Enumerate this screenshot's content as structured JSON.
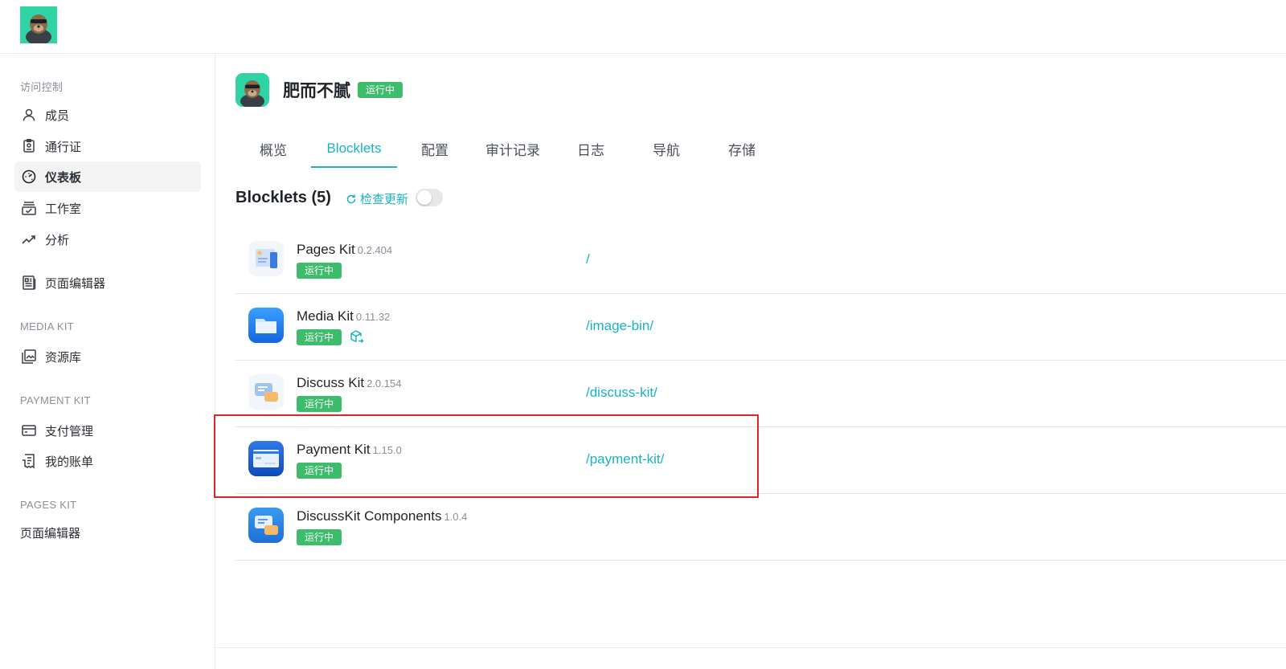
{
  "header": {
    "logo_icon": "otter-mascot-logo"
  },
  "sidebar": {
    "groups": [
      {
        "title": "访问控制",
        "items": [
          {
            "label": "成员",
            "icon": "user-icon"
          },
          {
            "label": "通行证",
            "icon": "pass-icon"
          },
          {
            "label": "仪表板",
            "icon": "dashboard-icon",
            "active": true
          },
          {
            "label": "工作室",
            "icon": "studio-icon"
          },
          {
            "label": "分析",
            "icon": "analytics-icon"
          },
          {
            "label": "页面编辑器",
            "icon": "newspaper-icon"
          }
        ]
      },
      {
        "title": "MEDIA KIT",
        "items": [
          {
            "label": "资源库",
            "icon": "image-library-icon"
          }
        ]
      },
      {
        "title": "PAYMENT KIT",
        "items": [
          {
            "label": "支付管理",
            "icon": "credit-card-icon"
          },
          {
            "label": "我的账单",
            "icon": "bill-icon"
          }
        ]
      },
      {
        "title": "PAGES KIT",
        "items": [
          {
            "label": "页面编辑器"
          }
        ]
      }
    ]
  },
  "app": {
    "name": "肥而不腻",
    "status": "运行中"
  },
  "tabs": [
    "概览",
    "Blocklets",
    "配置",
    "审计记录",
    "日志",
    "导航",
    "存储"
  ],
  "active_tab": "Blocklets",
  "blocklets_section": {
    "title": "Blocklets (5)",
    "check_update_label": "检查更新",
    "toggle_on": false
  },
  "blocklets": [
    {
      "name": "Pages Kit",
      "version": "0.2.404",
      "status": "运行中",
      "path": "/",
      "icon": "pages-kit-icon"
    },
    {
      "name": "Media Kit",
      "version": "0.11.32",
      "status": "运行中",
      "path": "/image-bin/",
      "icon": "media-kit-folder-icon",
      "extra_icon": "cube-share-icon"
    },
    {
      "name": "Discuss Kit",
      "version": "2.0.154",
      "status": "运行中",
      "path": "/discuss-kit/",
      "icon": "discuss-kit-icon"
    },
    {
      "name": "Payment Kit",
      "version": "1.15.0",
      "status": "运行中",
      "path": "/payment-kit/",
      "icon": "payment-kit-card-icon",
      "highlighted": true
    },
    {
      "name": "DiscussKit Components",
      "version": "1.0.4",
      "status": "运行中",
      "path": "",
      "icon": "discusskit-components-icon"
    }
  ],
  "colors": {
    "accent": "#17b3c5",
    "status_green": "#3dbd6b",
    "highlight_red": "#e0242c"
  }
}
